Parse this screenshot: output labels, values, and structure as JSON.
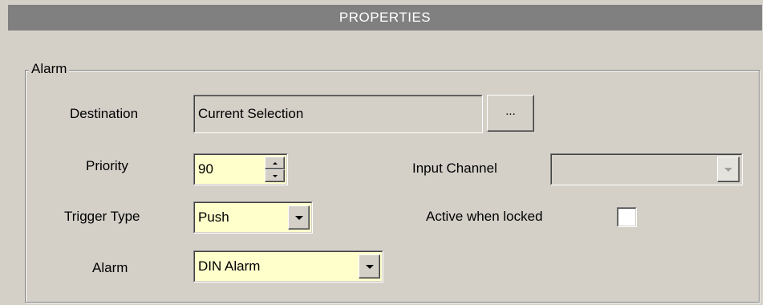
{
  "header": {
    "title": "PROPERTIES"
  },
  "group": {
    "legend": "Alarm"
  },
  "fields": {
    "destination": {
      "label": "Destination",
      "value": "Current Selection",
      "browse_label": "..."
    },
    "priority": {
      "label": "Priority",
      "value": "90"
    },
    "input_channel": {
      "label": "Input Channel",
      "value": ""
    },
    "trigger_type": {
      "label": "Trigger Type",
      "value": "Push"
    },
    "active_when_locked": {
      "label": "Active when locked",
      "checked": false
    },
    "alarm": {
      "label": "Alarm",
      "value": "DIN Alarm"
    }
  },
  "colors": {
    "panel": "#d4d0c8",
    "header": "#808080",
    "editable_field": "#ffffcc",
    "readonly_field": "#d4d0c8"
  }
}
